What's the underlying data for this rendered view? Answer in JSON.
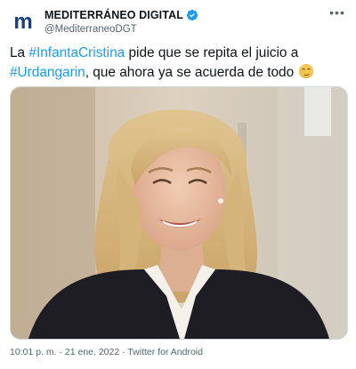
{
  "author": {
    "display_name": "MEDITERRÁNEO DIGITAL",
    "handle": "@MediterraneoDGT",
    "avatar_letter": "m",
    "avatar_color": "#1c3f7a",
    "verified": true,
    "verified_color": "#1d9bf0"
  },
  "menu_icon": "more-horizontal-icon",
  "tweet": {
    "text_1": "La ",
    "hashtag_1": "#InfantaCristina",
    "text_2": " pide que se repita el juicio a ",
    "hashtag_2": "#Urdangarin",
    "text_3": ", que ahora ya se acuerda de todo",
    "emoji": "smirking-face"
  },
  "media": {
    "type": "photo",
    "subject": "smiling woman with blonde hair in dark blazer and white shirt"
  },
  "meta": {
    "time": "10:01 p. m.",
    "sep_1": " · ",
    "date": "21 ene. 2022",
    "sep_2": " · ",
    "source": "Twitter for Android"
  },
  "colors": {
    "hashtag": "#1d9bf0",
    "text": "#0f1419",
    "muted": "#536471"
  }
}
